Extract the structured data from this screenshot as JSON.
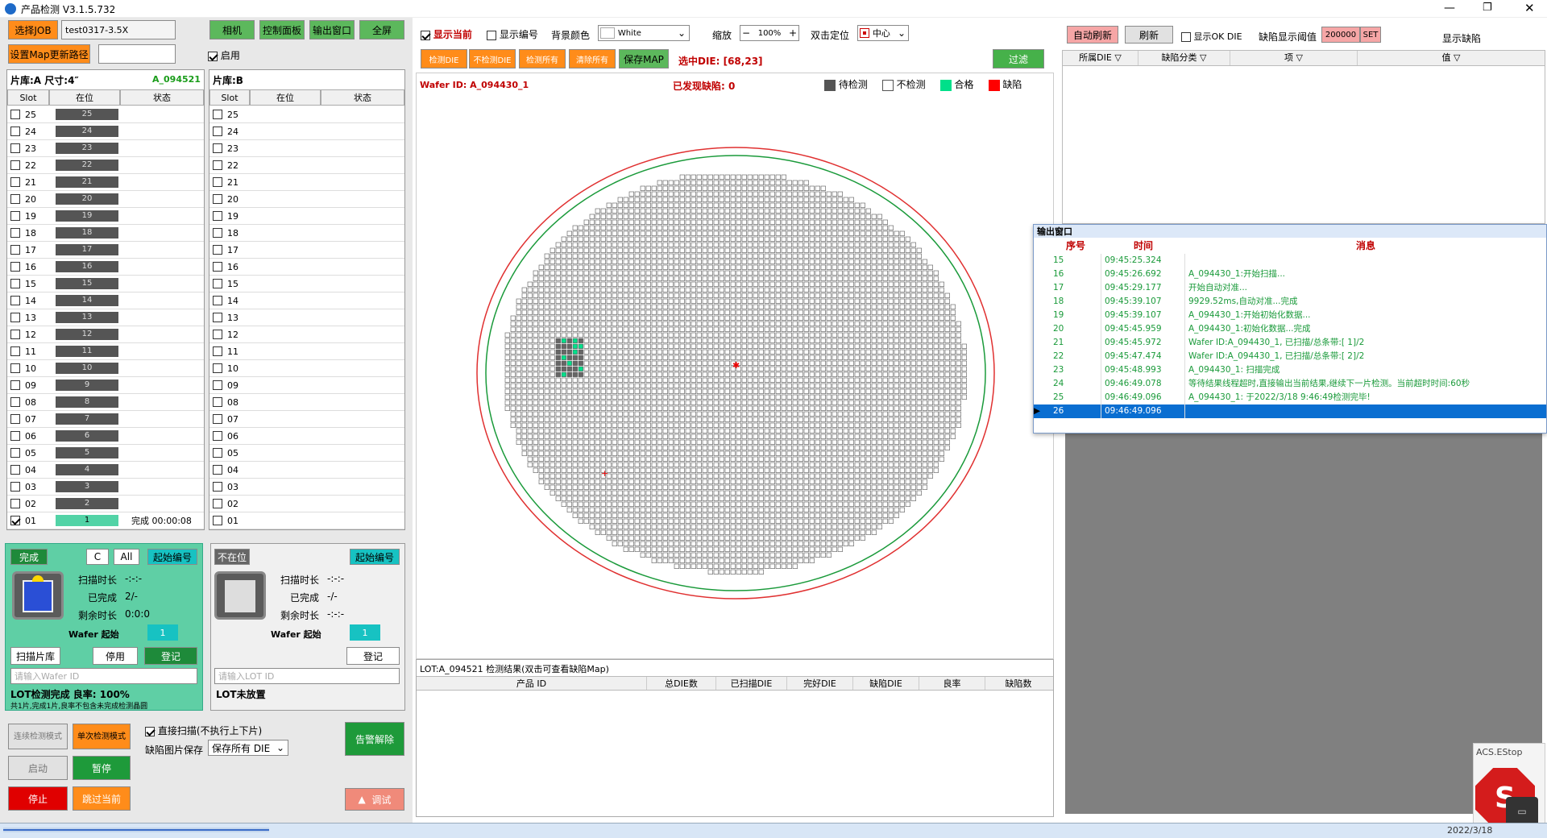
{
  "app": {
    "title": "产品检测 V3.1.5.732",
    "logo": "app-logo-icon"
  },
  "toolbar": {
    "select_job": "选择JOB",
    "job_name": "test0317-3.5X",
    "set_map_path": "设置Map更新路径",
    "enable_label": "启用",
    "camera": "相机",
    "control_panel": "控制面板",
    "output_window": "输出窗口",
    "fullscreen": "全屏"
  },
  "cassette_a": {
    "title": "片库:A 尺寸:4″",
    "lot": "A_094521",
    "col_slot": "Slot",
    "col_present": "在位",
    "col_status": "状态",
    "rows": [
      {
        "slot": "25",
        "num": "25",
        "status": ""
      },
      {
        "slot": "24",
        "num": "24",
        "status": ""
      },
      {
        "slot": "23",
        "num": "23",
        "status": ""
      },
      {
        "slot": "22",
        "num": "22",
        "status": ""
      },
      {
        "slot": "21",
        "num": "21",
        "status": ""
      },
      {
        "slot": "20",
        "num": "20",
        "status": ""
      },
      {
        "slot": "19",
        "num": "19",
        "status": ""
      },
      {
        "slot": "18",
        "num": "18",
        "status": ""
      },
      {
        "slot": "17",
        "num": "17",
        "status": ""
      },
      {
        "slot": "16",
        "num": "16",
        "status": ""
      },
      {
        "slot": "15",
        "num": "15",
        "status": ""
      },
      {
        "slot": "14",
        "num": "14",
        "status": ""
      },
      {
        "slot": "13",
        "num": "13",
        "status": ""
      },
      {
        "slot": "12",
        "num": "12",
        "status": ""
      },
      {
        "slot": "11",
        "num": "11",
        "status": ""
      },
      {
        "slot": "10",
        "num": "10",
        "status": ""
      },
      {
        "slot": "09",
        "num": "9",
        "status": ""
      },
      {
        "slot": "08",
        "num": "8",
        "status": ""
      },
      {
        "slot": "07",
        "num": "7",
        "status": ""
      },
      {
        "slot": "06",
        "num": "6",
        "status": ""
      },
      {
        "slot": "05",
        "num": "5",
        "status": ""
      },
      {
        "slot": "04",
        "num": "4",
        "status": ""
      },
      {
        "slot": "03",
        "num": "3",
        "status": ""
      },
      {
        "slot": "02",
        "num": "2",
        "status": ""
      },
      {
        "slot": "01",
        "num": "1",
        "status": "完成 00:00:08"
      }
    ]
  },
  "cassette_b": {
    "title": "片库:B",
    "col_slot": "Slot",
    "col_present": "在位",
    "col_status": "状态",
    "slots": [
      "25",
      "24",
      "23",
      "22",
      "21",
      "20",
      "19",
      "18",
      "17",
      "16",
      "15",
      "14",
      "13",
      "12",
      "11",
      "10",
      "09",
      "08",
      "07",
      "06",
      "05",
      "04",
      "03",
      "02",
      "01"
    ]
  },
  "panel_a": {
    "state": "完成",
    "c_btn": "C",
    "all_btn": "All",
    "start_num": "起始编号",
    "scan_time_label": "扫描时长",
    "scan_time": "-:-:-",
    "done_label": "已完成",
    "done": "2/-",
    "remain_label": "剩余时长",
    "remain": "0:0:0",
    "wafer_start": "Wafer 起始",
    "wafer_start_val": "1",
    "scan_lib": "扫描片库",
    "stop_use": "停用",
    "register": "登记",
    "wafer_placeholder": "请输入Wafer ID",
    "result": "LOT检测完成 良率: 100%",
    "note": "共1片,完成1片,良率不包含未完成检测晶圆"
  },
  "panel_b": {
    "state": "不在位",
    "start_num": "起始编号",
    "scan_time_label": "扫描时长",
    "scan_time": "-:-:-",
    "done_label": "已完成",
    "done": "-/-",
    "remain_label": "剩余时长",
    "remain": "-:-:-",
    "wafer_start": "Wafer 起始",
    "wafer_start_val": "1",
    "register": "登记",
    "lot_placeholder": "请输入LOT ID",
    "result": "LOT未放置"
  },
  "controls": {
    "continuous": "连续检测模式",
    "single": "单次检测模式",
    "start": "启动",
    "pause": "暂停",
    "stop": "停止",
    "skip": "跳过当前",
    "direct_scan": "直接扫描(不执行上下片)",
    "defect_save_label": "缺陷图片保存",
    "defect_save_val": "保存所有 DIE",
    "alarm_clear": "告警解除",
    "debug": "调试"
  },
  "map_toolbar": {
    "show_current": "显示当前",
    "show_number": "显示编号",
    "bg_color_label": "背景颜色",
    "bg_color": "White",
    "zoom_label": "缩放",
    "zoom": "100%",
    "dblclick_label": "双击定位",
    "dblclick_val": "中心",
    "btn1": "检测DIE",
    "btn2": "不检测DIE",
    "btn3": "检测所有",
    "btn4": "清除所有",
    "save_map": "保存MAP",
    "selected_die": "选中DIE: [68,23]",
    "filter": "过滤"
  },
  "map": {
    "wafer_id": "Wafer ID: A_094430_1",
    "found_defect": "已发现缺陷: 0",
    "legend": [
      "待检测",
      "不检测",
      "合格",
      "缺陷"
    ],
    "legend_colors": [
      "#555555",
      "#ffffff",
      "#00e08a",
      "#ff0000"
    ]
  },
  "lot_table": {
    "title": "LOT:A_094521 检测结果(双击可查看缺陷Map)",
    "cols": [
      "产品 ID",
      "总DIE数",
      "已扫描DIE",
      "完好DIE",
      "缺陷DIE",
      "良率",
      "缺陷数"
    ]
  },
  "right": {
    "auto_refresh": "自动刷新",
    "refresh": "刷新",
    "show_ok": "显示OK DIE",
    "threshold_label": "缺陷显示阈值",
    "threshold": "200000",
    "set": "SET",
    "show_defect": "显示缺陷",
    "cols": [
      "所属DIE",
      "缺陷分类",
      "项",
      "值"
    ]
  },
  "output": {
    "title": "输出窗口",
    "cols": [
      "序号",
      "时间",
      "消息"
    ],
    "rows": [
      {
        "n": "15",
        "t": "09:45:25.324",
        "m": ""
      },
      {
        "n": "16",
        "t": "09:45:26.692",
        "m": "A_094430_1:开始扫描..."
      },
      {
        "n": "17",
        "t": "09:45:29.177",
        "m": "开始自动对准..."
      },
      {
        "n": "18",
        "t": "09:45:39.107",
        "m": "9929.52ms,自动对准...完成"
      },
      {
        "n": "19",
        "t": "09:45:39.107",
        "m": "A_094430_1:开始初始化数据..."
      },
      {
        "n": "20",
        "t": "09:45:45.959",
        "m": "A_094430_1:初始化数据...完成"
      },
      {
        "n": "21",
        "t": "09:45:45.972",
        "m": "Wafer ID:A_094430_1, 已扫描/总条带:[ 1]/2"
      },
      {
        "n": "22",
        "t": "09:45:47.474",
        "m": "Wafer ID:A_094430_1, 已扫描/总条带:[ 2]/2"
      },
      {
        "n": "23",
        "t": "09:45:48.993",
        "m": "A_094430_1: 扫描完成"
      },
      {
        "n": "24",
        "t": "09:46:49.078",
        "m": "等待结果线程超时,直接输出当前结果,继续下一片检测。当前超时时间:60秒"
      },
      {
        "n": "25",
        "t": "09:46:49.096",
        "m": "A_094430_1: 于2022/3/18 9:46:49检测完毕!"
      },
      {
        "n": "26",
        "t": "09:46:49.096",
        "m": ""
      }
    ]
  },
  "estop": {
    "label": "ACS.EStop",
    "letter": "S"
  },
  "statusbar": {
    "date": "2022/3/18"
  }
}
